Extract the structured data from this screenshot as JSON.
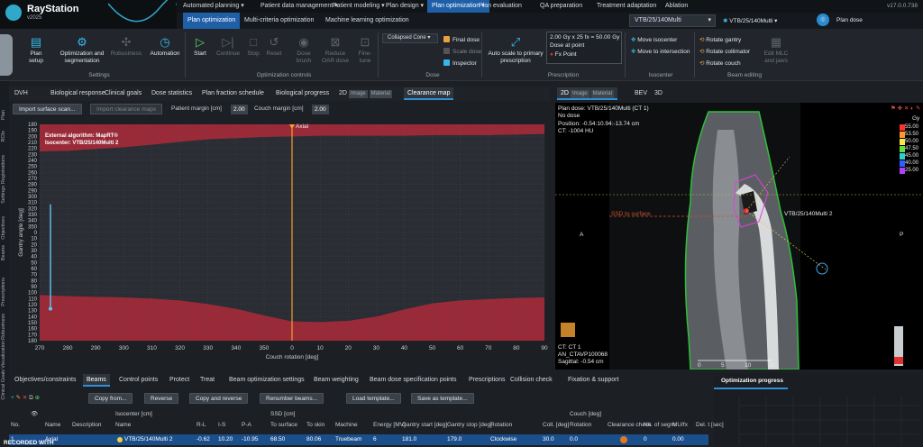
{
  "app": {
    "name": "RayStation",
    "version_label": "v2025",
    "build": "v17.0.0.738"
  },
  "main_tabs": [
    "Automated planning",
    "Patient data management",
    "Patient modeling",
    "Plan design",
    "Plan optimization",
    "Plan evaluation",
    "QA preparation",
    "Treatment adaptation",
    "Ablation"
  ],
  "main_active": 4,
  "sub_tabs": [
    "Plan optimization",
    "Multi-criteria optimization",
    "Machine learning optimization"
  ],
  "sub_active": 0,
  "plan_select": "VTB/25/140Multi",
  "beamset_select": "VTB/25/140Multi",
  "plan_dose_label": "Plan dose",
  "ribbon": {
    "plan_setup": "Plan setup",
    "opt_seg": "Optimization and segmentation",
    "robustness": "Robustness",
    "automation": "Automation",
    "settings_group": "Settings",
    "start": "Start",
    "continue": "Continue",
    "stop": "Stop",
    "reset": "Reset",
    "dose_brush": "Dose brush",
    "reduce_oar": "Reduce OAR dose",
    "fine_tune": "Fine-tune",
    "opt_controls_group": "Optimization controls",
    "dose_algo": "Collapsed Cone",
    "final_dose": "Final dose",
    "scale_dose": "Scale dose",
    "inspector": "Inspector",
    "dose_group": "Dose",
    "auto_scale": "Auto scale to primary prescription",
    "rx_line1": "2.00 Gy x 25 fx = 50.00 Gy",
    "rx_line2": "Dose at point",
    "rx_line3": "Fx Point",
    "prescription_group": "Prescription",
    "move_iso": "Move isocenter",
    "move_inter": "Move to intersection",
    "iso_group": "Isocenter",
    "rot_gantry": "Rotate gantry",
    "rot_coll": "Rotate collimator",
    "rot_couch": "Rotate couch",
    "edit_mlc": "Edit MLC and jaws",
    "beam_group": "Beam editing"
  },
  "left_tabs": [
    "DVH",
    "Biological response",
    "Clinical goals",
    "Dose statistics",
    "Plan fraction schedule",
    "Biological progress",
    "2D",
    "Clearance map"
  ],
  "left_tabs_active": 7,
  "left_tab_2d_sub": [
    "Image",
    "Material"
  ],
  "left_strip": [
    "Plan",
    "ROIs",
    "Registrations",
    "Settings",
    "Objectives",
    "Beams",
    "Prescriptions",
    "Robustness",
    "Visualization",
    "Clinical Goals"
  ],
  "clearance": {
    "import_surface": "Import surface scan...",
    "import_maps": "Import clearance maps",
    "patient_margin_label": "Patient margin [cm]",
    "patient_margin": "2.00",
    "couch_margin_label": "Couch margin [cm]",
    "couch_margin": "2.00",
    "algo_line1": "External algorithm: MapRT®",
    "algo_line2": "Isocenter: VTB/25/140Multi 2",
    "axial_label": "Axial"
  },
  "chart_data": {
    "type": "area",
    "xlabel": "Couch rotation [deg]",
    "ylabel": "Gantry angle [deg]",
    "x_ticks": [
      "270",
      "280",
      "290",
      "300",
      "310",
      "320",
      "330",
      "340",
      "350",
      "0",
      "10",
      "20",
      "30",
      "40",
      "50",
      "60",
      "70",
      "80",
      "90"
    ],
    "y_ticks": [
      180,
      190,
      200,
      210,
      220,
      230,
      240,
      250,
      260,
      270,
      280,
      290,
      300,
      310,
      320,
      330,
      340,
      350,
      0,
      10,
      20,
      30,
      40,
      50,
      60,
      70,
      80,
      90,
      100,
      110,
      120,
      130,
      140,
      150,
      160,
      170,
      180
    ],
    "upper_region_bottom": [
      225,
      224,
      221,
      218,
      214,
      209,
      205,
      203,
      201,
      200,
      199,
      199,
      199,
      199,
      198,
      198,
      198,
      197,
      196
    ],
    "lower_region_top": [
      104,
      106,
      107,
      108,
      110,
      113,
      119,
      127,
      138,
      148,
      149,
      147,
      140,
      128,
      118,
      113,
      111,
      109,
      108
    ],
    "axial_marker_x": "0",
    "current_beam": {
      "x": 270,
      "y_from": 127,
      "y_to": 313
    },
    "colors": {
      "collision": "#9b2a38",
      "free": "#2a2d33",
      "axial": "#f0a030",
      "beam": "#5ec8f0"
    }
  },
  "right_tabs": [
    "2D",
    "BEV",
    "3D"
  ],
  "right_2d_sub": [
    "Image",
    "Material"
  ],
  "ct": {
    "line1": "Plan dose: VTB/25/140Multi (CT 1)",
    "line2": "No dose",
    "line3": "Position: -0.54:10.94:-13.74 cm",
    "line4": "CT: -1004 HU",
    "left": "A",
    "right": "P",
    "ssd": "SSD to surface",
    "beam_label": "VTB/25/140Multi 2",
    "bl1": "CT: CT 1",
    "bl2": "AN_CTAVP100068",
    "bl3": "Sagittal: -0.54 cm",
    "scale": [
      "0",
      "5",
      "10",
      "15"
    ],
    "legend_unit": "Gy",
    "legend": [
      {
        "v": "55.00",
        "c": "#ff3030"
      },
      {
        "v": "53.50",
        "c": "#ff9a30"
      },
      {
        "v": "50.00",
        "c": "#ffe640"
      },
      {
        "v": "47.50",
        "c": "#60e040"
      },
      {
        "v": "45.00",
        "c": "#30d0d0"
      },
      {
        "v": "40.00",
        "c": "#3060ff"
      },
      {
        "v": "25.00",
        "c": "#b040ff"
      }
    ]
  },
  "bottom_tabs": [
    "Objectives/constraints",
    "Beams",
    "Control points",
    "Protect",
    "Treat",
    "Beam optimization settings",
    "Beam weighting",
    "Beam dose specification points",
    "Prescriptions",
    "Collision check",
    "Fixation & support"
  ],
  "bottom_active": 1,
  "beam_buttons": [
    "Copy from...",
    "Reverse",
    "Copy and reverse",
    "Renumber beams...",
    "Load template...",
    "Save as template..."
  ],
  "columns": [
    "No.",
    "",
    "Name",
    "Description",
    "Isocenter [cm] Name",
    "R-L",
    "I-S",
    "P-A",
    "SSD [cm] To surface",
    "To skin",
    "Machine",
    "Energy [MV]",
    "Gantry start [deg]",
    "Gantry stop [deg]",
    "Rotation",
    "Coll. [deg]",
    "Couch [deg] Rotation",
    "Clearance check",
    "No. of segm.",
    "MU/fx",
    "Del. t [sec]"
  ],
  "row": [
    "1",
    "",
    "Axial",
    "",
    "VTB/25/140Multi 2",
    "-0.62",
    "10.20",
    "-10.95",
    "68.50",
    "80.06",
    "Truebeam",
    "6",
    "181.0",
    "179.0",
    "Clockwise",
    "30.0",
    "0.0",
    "",
    "0",
    "0.00",
    ""
  ],
  "recorded": "RECORDED WITH",
  "opt_progress": "Optimization progress"
}
